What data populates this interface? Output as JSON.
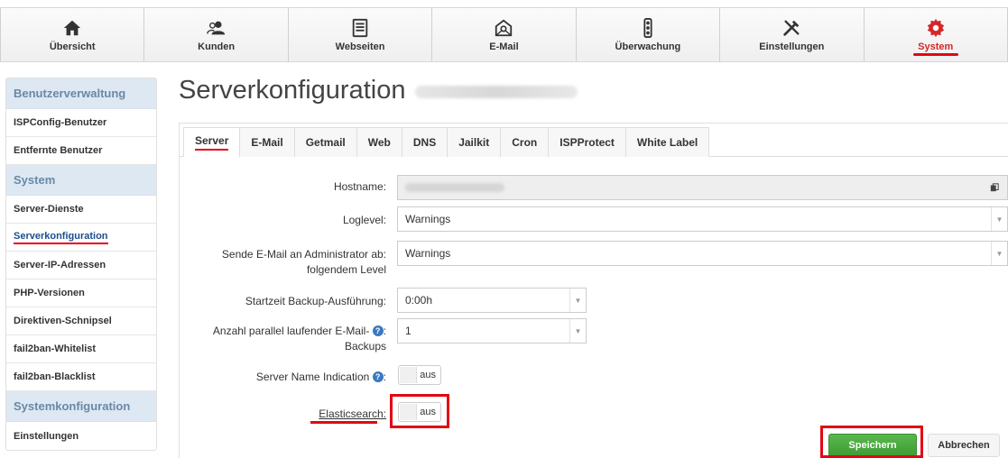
{
  "nav": [
    {
      "label": "Übersicht",
      "icon": "home-icon"
    },
    {
      "label": "Kunden",
      "icon": "users-icon"
    },
    {
      "label": "Webseiten",
      "icon": "document-icon"
    },
    {
      "label": "E-Mail",
      "icon": "mail-icon"
    },
    {
      "label": "Überwachung",
      "icon": "traffic-light-icon"
    },
    {
      "label": "Einstellungen",
      "icon": "tools-icon"
    },
    {
      "label": "System",
      "icon": "gear-icon",
      "active": true
    }
  ],
  "sidebar": {
    "sections": [
      {
        "header": "Benutzerverwaltung",
        "items": [
          "ISPConfig-Benutzer",
          "Entfernte Benutzer"
        ]
      },
      {
        "header": "System",
        "items": [
          "Server-Dienste",
          "Serverkonfiguration",
          "Server-IP-Adressen",
          "PHP-Versionen",
          "Direktiven-Schnipsel",
          "fail2ban-Whitelist",
          "fail2ban-Blacklist"
        ]
      },
      {
        "header": "Systemkonfiguration",
        "items": [
          "Einstellungen"
        ]
      }
    ],
    "active_item": "Serverkonfiguration"
  },
  "page": {
    "title": "Serverkonfiguration"
  },
  "tabs": [
    "Server",
    "E-Mail",
    "Getmail",
    "Web",
    "DNS",
    "Jailkit",
    "Cron",
    "ISPProtect",
    "White Label"
  ],
  "active_tab": "Server",
  "form": {
    "hostname_label": "Hostname:",
    "loglevel_label": "Loglevel:",
    "loglevel_value": "Warnings",
    "admin_mail_label_1": "Sende E-Mail an Administrator ab:",
    "admin_mail_label_2": "folgendem Level",
    "admin_mail_value": "Warnings",
    "backup_time_label": "Startzeit Backup-Ausführung:",
    "backup_time_value": "0:00h",
    "parallel_label_1": "Anzahl parallel laufender E-Mail-",
    "parallel_label_2": "Backups",
    "parallel_value": "1",
    "sni_label": "Server Name Indication",
    "sni_value": "aus",
    "elastic_label": "Elasticsearch:",
    "elastic_value": "aus",
    "colon": ":",
    "help_glyph": "?"
  },
  "buttons": {
    "save": "Speichern",
    "cancel": "Abbrechen"
  },
  "colors": {
    "accent_red": "#e30613",
    "save_green": "#4aa83f",
    "sidebar_header": "#dde8f3"
  }
}
